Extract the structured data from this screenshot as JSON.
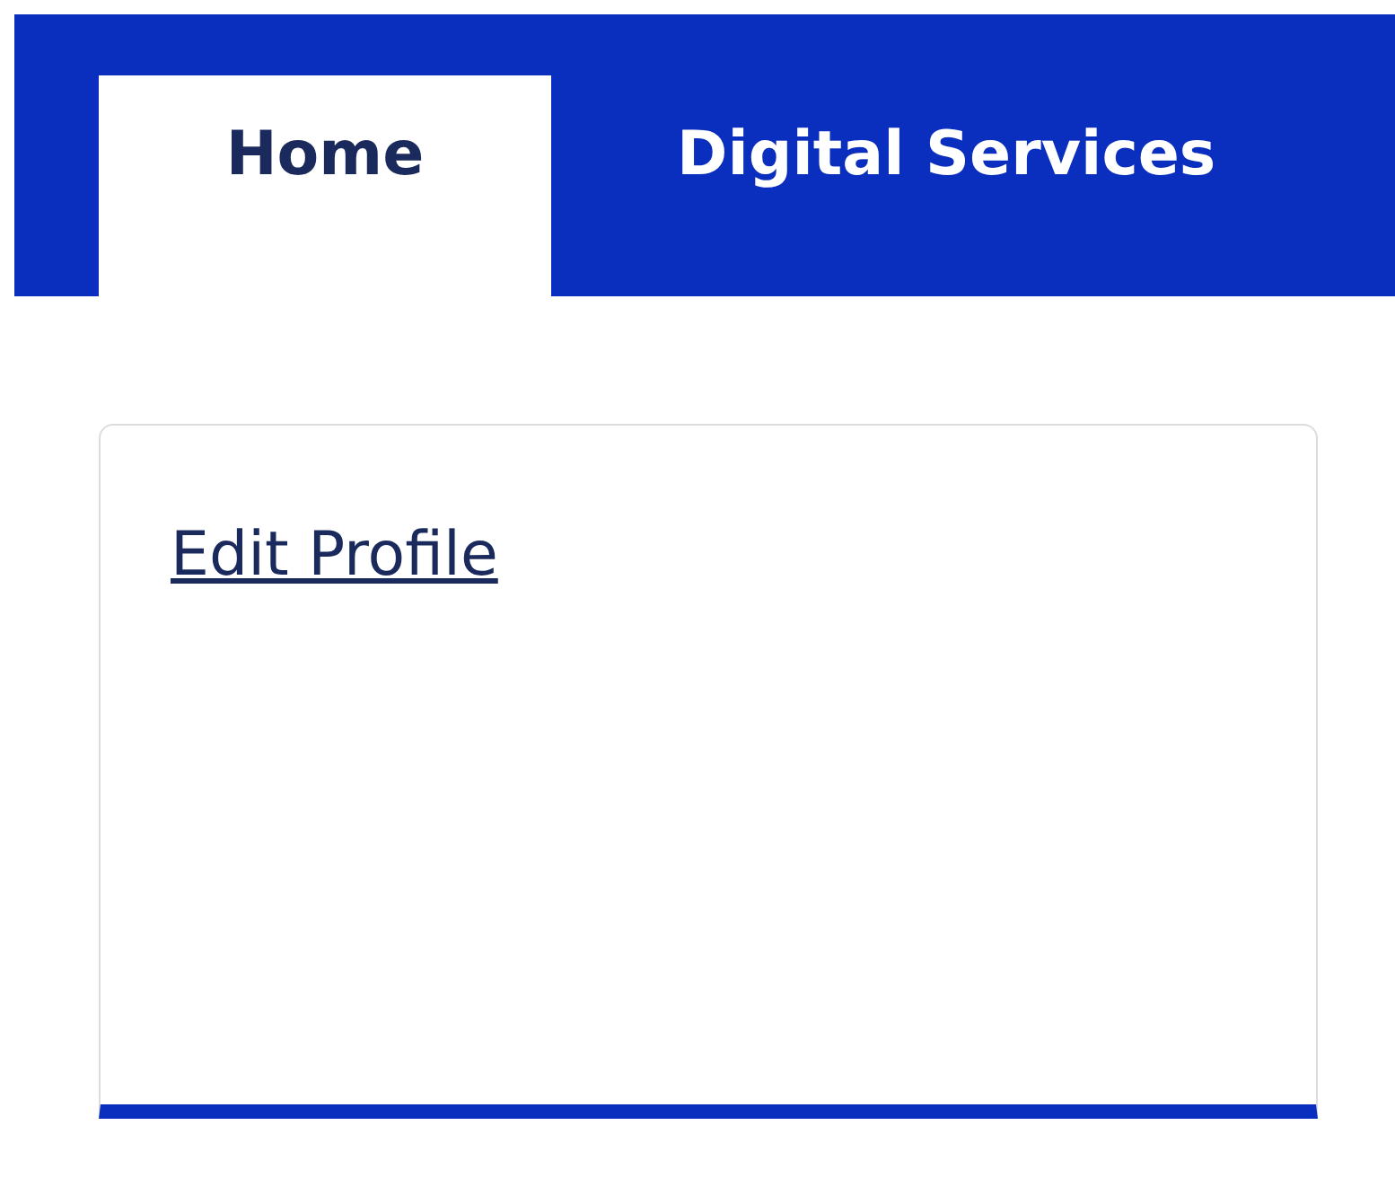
{
  "tabs": [
    {
      "label": "Home",
      "selected": true
    },
    {
      "label": "Digital Services",
      "selected": false
    }
  ],
  "card": {
    "link": "Edit Profile"
  }
}
